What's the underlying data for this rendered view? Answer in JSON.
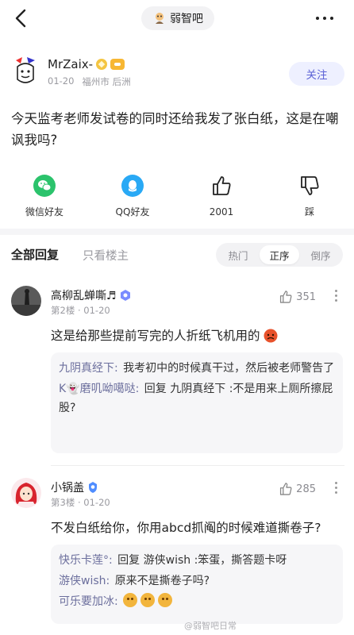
{
  "header": {
    "forum_name": "弱智吧"
  },
  "author": {
    "name": "MrZaix-",
    "date": "01-20",
    "location": "福州市 后洲",
    "follow_label": "关注"
  },
  "post": {
    "text": "今天监考老师发试卷的同时还给我发了张白纸，这是在嘲讽我吗?"
  },
  "actions": {
    "wechat": "微信好友",
    "qq": "QQ好友",
    "like_count": "2001",
    "dislike": "踩"
  },
  "colors": {
    "wechat": "#2bc36c",
    "qq": "#29a9f5",
    "accent": "#5c62d6"
  },
  "tabs": {
    "all": "全部回复",
    "owner": "只看楼主"
  },
  "sort": {
    "hot": "热门",
    "asc": "正序",
    "desc": "倒序",
    "selected": "正序"
  },
  "replies": [
    {
      "name": "高柳乱蝉嘶♬",
      "floor": "第2楼",
      "date": "01-20",
      "likes": "351",
      "text": "这是给那些提前写完的人折纸飞机用的",
      "subs": [
        {
          "who": "九阴真经下:",
          "text": "我考初中的时候真干过，然后被老师警告了"
        },
        {
          "who": "K👻磨叽呦噶哒:",
          "text": "回复 九阴真经下 :不是用来上厕所擦屁股?"
        }
      ]
    },
    {
      "name": "小锅盖",
      "floor": "第3楼",
      "date": "01-20",
      "likes": "285",
      "text": "不发白纸给你，你用abcd抓阄的时候难道撕卷子?",
      "subs": [
        {
          "who": "快乐卡莲°:",
          "text": "回复 游侠wish :笨蛋，撕答题卡呀"
        },
        {
          "who": "游侠wish:",
          "text": "原来不是撕卷子吗?"
        },
        {
          "who": "可乐要加冰:",
          "text": ""
        }
      ]
    }
  ],
  "watermark": "@弱智吧日常"
}
